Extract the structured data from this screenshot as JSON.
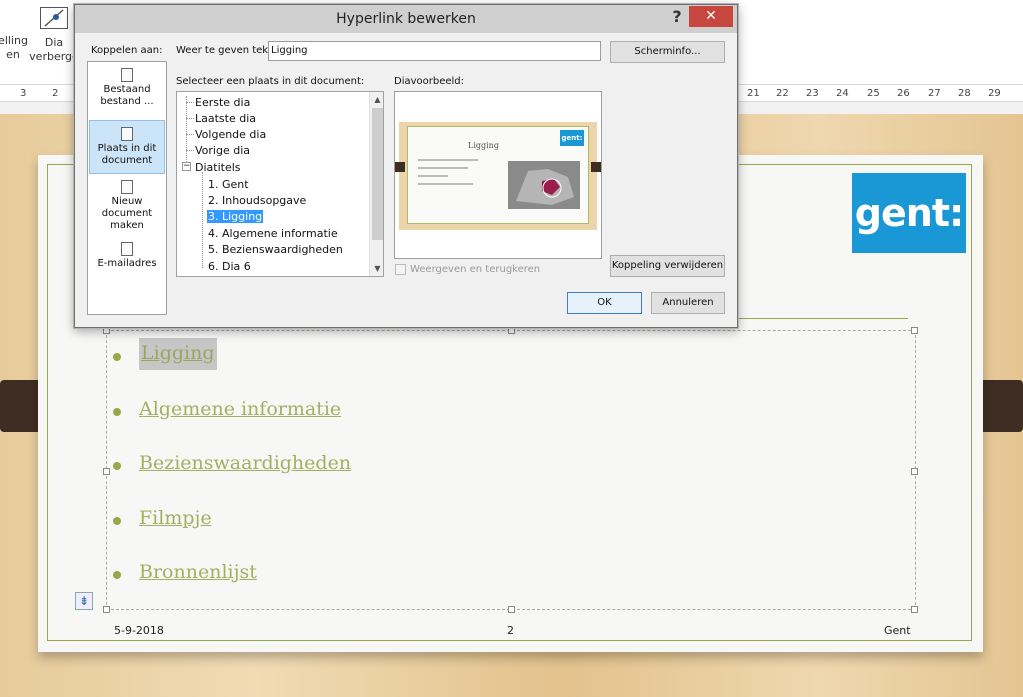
{
  "ribbon": {
    "btn1_label": "elling\nen",
    "btn2_label": "Dia\nverberge"
  },
  "ruler": {
    "left_ticks": [
      "3",
      "2"
    ],
    "right_ticks": [
      "21",
      "22",
      "23",
      "24",
      "25",
      "26",
      "27",
      "28",
      "29"
    ]
  },
  "slide": {
    "logo_text": "gent:",
    "bullets": [
      "Ligging",
      "Algemene informatie",
      "Bezienswaardigheden",
      "Filmpje",
      "Bronnenlijst"
    ],
    "footer_date": "5-9-2018",
    "footer_page": "2",
    "footer_right": "Gent"
  },
  "dialog": {
    "title": "Hyperlink bewerken",
    "help_label": "?",
    "close_label": "✕",
    "link_to_label": "Koppelen aan:",
    "link_options": [
      "Bestaand bestand ...",
      "Plaats in dit document",
      "Nieuw document maken",
      "E-mailadres"
    ],
    "display_text_label": "Weer te geven tekst:",
    "display_text_value": "Ligging",
    "screentip_button": "Scherminfo...",
    "select_place_label": "Selecteer een plaats in dit document:",
    "tree_items": [
      "Eerste dia",
      "Laatste dia",
      "Volgende dia",
      "Vorige dia",
      "Diatitels",
      "1. Gent",
      "2. Inhoudsopgave",
      "3. Ligging",
      "4. Algemene informatie",
      "5. Bezienswaardigheden",
      "6. Dia 6"
    ],
    "preview_label": "Diavoorbeeld:",
    "preview_slide_title": "Ligging",
    "preview_logo": "gent:",
    "show_return_label": "Weergeven en terugkeren",
    "remove_link_button": "Koppeling verwijderen",
    "ok_button": "OK",
    "cancel_button": "Annuleren"
  }
}
